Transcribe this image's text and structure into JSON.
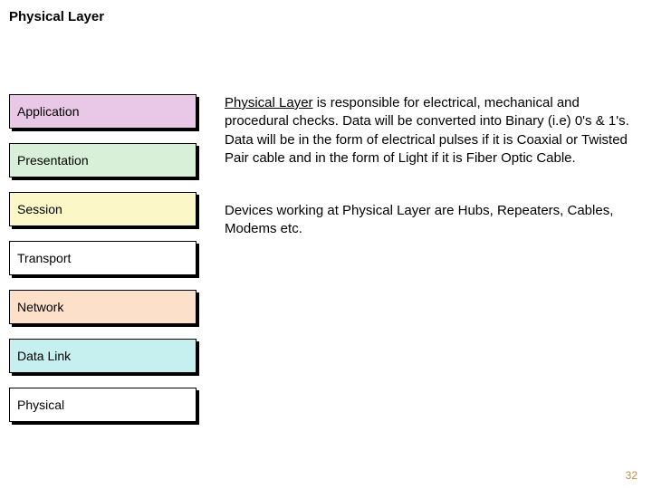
{
  "title": "Physical Layer",
  "layers": {
    "application": "Application",
    "presentation": "Presentation",
    "session": "Session",
    "transport": "Transport",
    "network": "Network",
    "datalink": "Data Link",
    "physical": "Physical"
  },
  "body": {
    "lead": "Physical Layer",
    "p1_rest": " is                        responsible for electrical, mechanical and procedural checks. Data will be converted into Binary (i.e) 0's & 1's. Data will be in the form of electrical pulses if it is Coaxial or Twisted Pair cable and in the form of Light if it is Fiber Optic Cable.",
    "p2": "Devices working at Physical Layer are Hubs, Repeaters, Cables, Modems etc."
  },
  "page_number": "32"
}
